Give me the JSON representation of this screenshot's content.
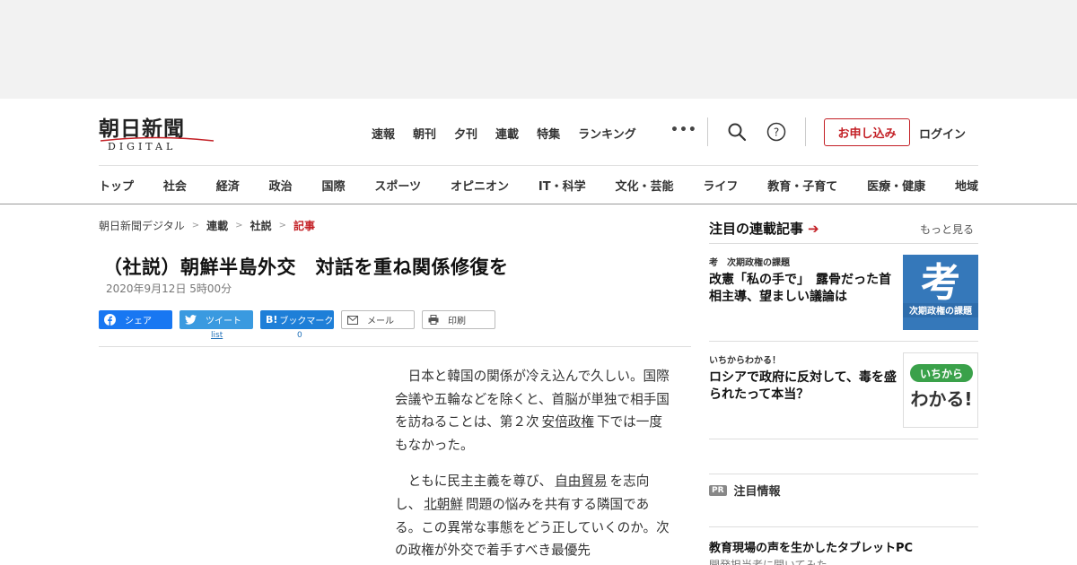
{
  "header": {
    "logo_text": "朝日新聞",
    "logo_sub": "DIGITAL",
    "top_nav": [
      "速報",
      "朝刊",
      "夕刊",
      "連載",
      "特集",
      "ランキング"
    ],
    "more_label": "•••",
    "apply_label": "お申し込み",
    "login_label": "ログイン"
  },
  "category_nav": [
    "トップ",
    "社会",
    "経済",
    "政治",
    "国際",
    "スポーツ",
    "オピニオン",
    "IT・科学",
    "文化・芸能",
    "ライフ",
    "教育・子育て",
    "医療・健康",
    "地域"
  ],
  "breadcrumb": {
    "home": "朝日新聞デジタル",
    "serial": "連載",
    "editorial": "社説",
    "current": "記事",
    "sep": ">"
  },
  "article": {
    "title": "（社説）朝鮮半島外交　対話を重ね関係修復を",
    "date": "2020年9月12日 5時00分",
    "p1_a": "日本と韓国の関係が冷え込んで久しい。国際会議や五輪などを除くと、首脳が単独で相手国を訪ねることは、第２次",
    "p1_kw": "安倍政権",
    "p1_b": "下では一度もなかった。",
    "p2_a": "ともに民主主義を尊び、",
    "p2_kw1": "自由貿易",
    "p2_b": "を志向し、",
    "p2_kw2": "北朝鮮",
    "p2_c": "問題の悩みを共有する隣国である。この異常な事態をどう正していくのか。次の政権が外交で着手すべき最優先"
  },
  "share": {
    "facebook": "シェア",
    "twitter": "ツイート",
    "hatena": "ブックマーク",
    "hatena_mark": "B!",
    "mail": "メール",
    "print": "印刷",
    "twitter_count": "list",
    "hatena_count": "0"
  },
  "sidebar": {
    "heading": "注目の連載記事",
    "arrow": "➔",
    "more": "もっと見る",
    "items": [
      {
        "category": "考　次期政権の課題",
        "title": "改憲「私の手で」　露骨だった首相主導、望ましい議論は",
        "thumb_char": "考",
        "thumb_caption": "次期政権の課題"
      },
      {
        "category": "いちからわかる！",
        "title": "ロシアで政府に反対して、毒を盛られたって本当？",
        "thumb_top": "いちから",
        "thumb_main": "わかる!"
      }
    ],
    "pr_badge": "PR",
    "pr_label": "注目情報",
    "pr_title": "教育現場の声を生かしたタブレットPC",
    "pr_sub": "開発担当者に聞いてみた"
  },
  "colors": {
    "accent_red": "#c31f25",
    "facebook": "#1877f2",
    "twitter": "#3a9ae0",
    "hatena": "#1e7fd8",
    "thumb_blue": "#3a7fc1",
    "thumb_green": "#3aa14a"
  }
}
